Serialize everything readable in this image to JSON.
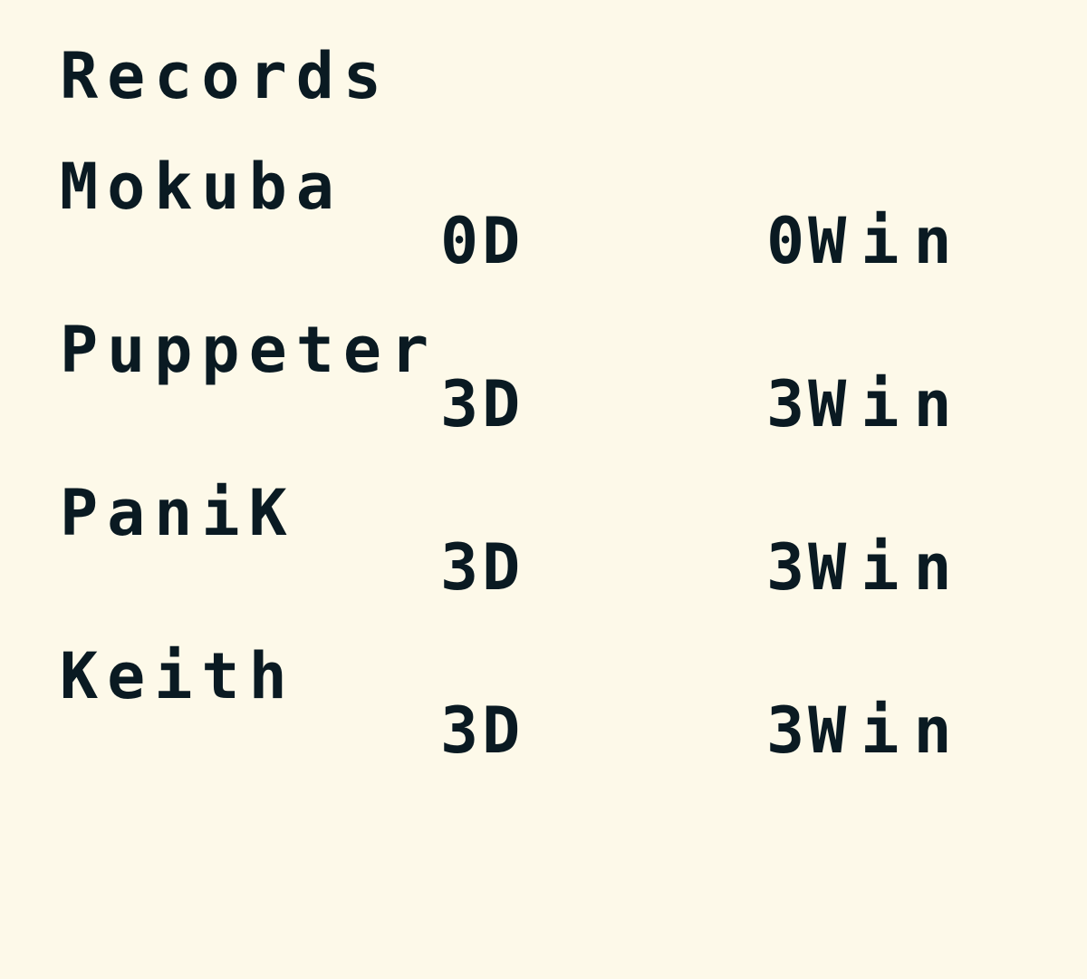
{
  "screen": {
    "title": "Records"
  },
  "records": [
    {
      "name": "Mokuba",
      "duels": "0D",
      "wins": "0",
      "wins_unit": "Win"
    },
    {
      "name": "Puppeter",
      "duels": "3D",
      "wins": "3",
      "wins_unit": "Win"
    },
    {
      "name": "PaniK",
      "duels": "3D",
      "wins": "3",
      "wins_unit": "Win"
    },
    {
      "name": "Keith",
      "duels": "3D",
      "wins": "3",
      "wins_unit": "Win"
    }
  ],
  "colors": {
    "background": "#fdf9e9",
    "text": "#0a1a22"
  }
}
